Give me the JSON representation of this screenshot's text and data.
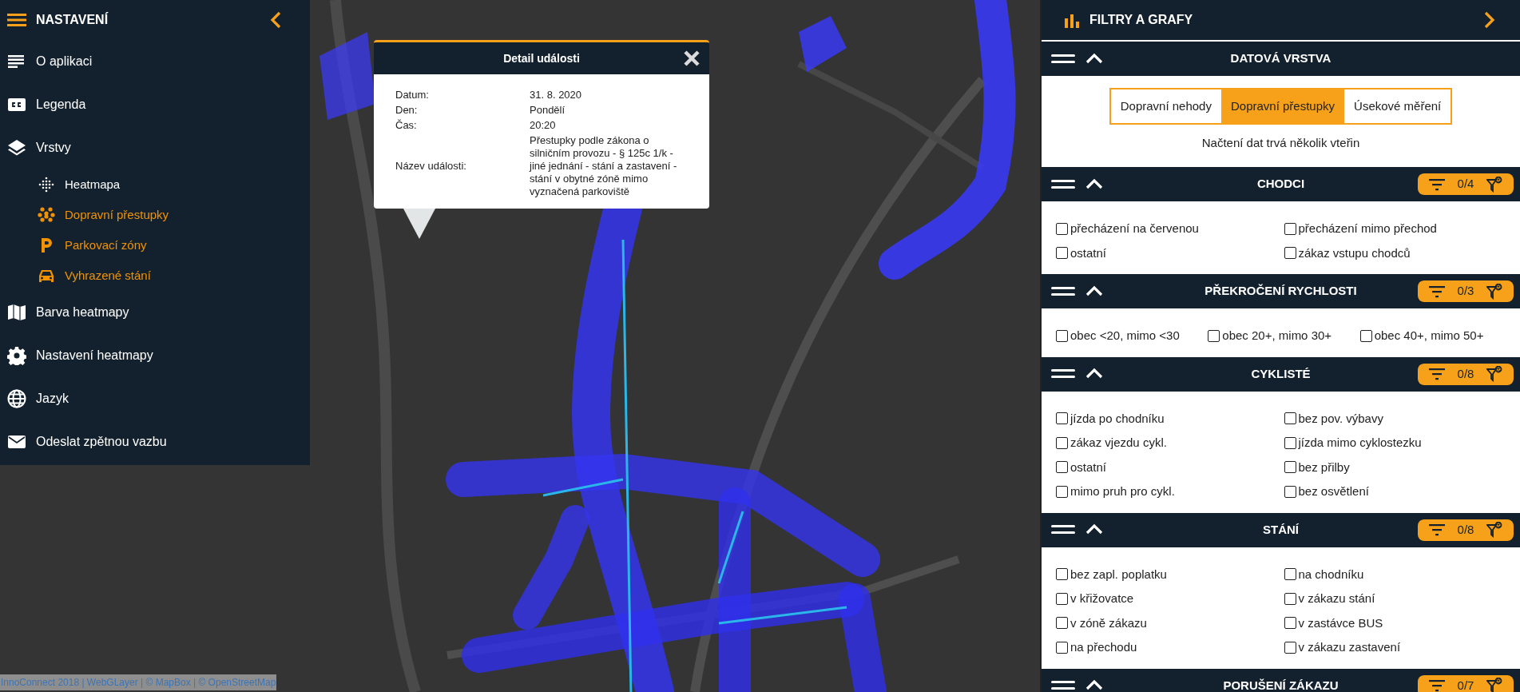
{
  "sidebar": {
    "title": "NASTAVENÍ",
    "items": [
      {
        "label": "O aplikaci"
      },
      {
        "label": "Legenda"
      },
      {
        "label": "Vrstvy",
        "children": [
          {
            "label": "Heatmapa",
            "on": false
          },
          {
            "label": "Dopravní přestupky",
            "on": true
          },
          {
            "label": "Parkovací zóny",
            "on": true
          },
          {
            "label": "Vyhrazené stání",
            "on": true
          }
        ]
      },
      {
        "label": "Barva heatmapy"
      },
      {
        "label": "Nastavení heatmapy"
      },
      {
        "label": "Jazyk"
      },
      {
        "label": "Odeslat zpětnou vazbu"
      }
    ]
  },
  "popup": {
    "title": "Detail události",
    "fields": [
      {
        "label": "Datum:",
        "value": "31. 8. 2020"
      },
      {
        "label": "Den:",
        "value": "Pondělí"
      },
      {
        "label": "Čas:",
        "value": "20:20"
      },
      {
        "label": "Název události:",
        "value": "Přestupky podle zákona o silničním provozu - § 125c 1/k - jiné jednání - stání a zastavení - stání v obytné zóně mimo vyznačená parkoviště"
      }
    ]
  },
  "attribution": "InnoConnect 2018 | WebGLayer | © MapBox | © OpenStreetMap",
  "panel": {
    "title": "FILTRY A GRAFY",
    "sections": [
      {
        "title": "DATOVÁ VRSTVA",
        "kind": "segmented",
        "options": [
          {
            "label": "Dopravní nehody",
            "selected": false
          },
          {
            "label": "Dopravní přestupky",
            "selected": true
          },
          {
            "label": "Úsekové měření",
            "selected": false
          }
        ],
        "note": "Načtení dat trvá několik vteřin"
      },
      {
        "title": "CHODCI",
        "kind": "checkboxes",
        "count": "0/4",
        "items": [
          {
            "label": "přecházení na červenou",
            "checked": false
          },
          {
            "label": "přecházení mimo přechod",
            "checked": false
          },
          {
            "label": "ostatní",
            "checked": false
          },
          {
            "label": "zákaz vstupu chodců",
            "checked": false
          }
        ]
      },
      {
        "title": "PŘEKROČENÍ RYCHLOSTI",
        "kind": "checkboxes",
        "count": "0/3",
        "items": [
          {
            "label": "obec <20, mimo <30",
            "checked": false
          },
          {
            "label": "obec 20+, mimo 30+",
            "checked": false
          },
          {
            "label": "obec 40+, mimo 50+",
            "checked": false
          }
        ]
      },
      {
        "title": "CYKLISTÉ",
        "kind": "checkboxes",
        "count": "0/8",
        "items": [
          {
            "label": "jízda po chodníku",
            "checked": false
          },
          {
            "label": "bez pov. výbavy",
            "checked": false
          },
          {
            "label": "zákaz vjezdu cykl.",
            "checked": false
          },
          {
            "label": "jízda mimo cyklostezku",
            "checked": false
          },
          {
            "label": "ostatní",
            "checked": false
          },
          {
            "label": "bez přilby",
            "checked": false
          },
          {
            "label": "mimo pruh pro cykl.",
            "checked": false
          },
          {
            "label": "bez osvětlení",
            "checked": false
          }
        ]
      },
      {
        "title": "STÁNÍ",
        "kind": "checkboxes",
        "count": "0/8",
        "items": [
          {
            "label": "bez zapl. poplatku",
            "checked": false
          },
          {
            "label": "na chodníku",
            "checked": false
          },
          {
            "label": "v křižovatce",
            "checked": false
          },
          {
            "label": "v zákazu stání",
            "checked": false
          },
          {
            "label": "v zóně zákazu",
            "checked": false
          },
          {
            "label": "v zastávce BUS",
            "checked": false
          },
          {
            "label": "na přechodu",
            "checked": false
          },
          {
            "label": "v zákazu zastavení",
            "checked": false
          }
        ]
      },
      {
        "title": "PORUŠENÍ ZÁKAZU",
        "kind": "checkboxes",
        "count": "0/7"
      }
    ]
  }
}
